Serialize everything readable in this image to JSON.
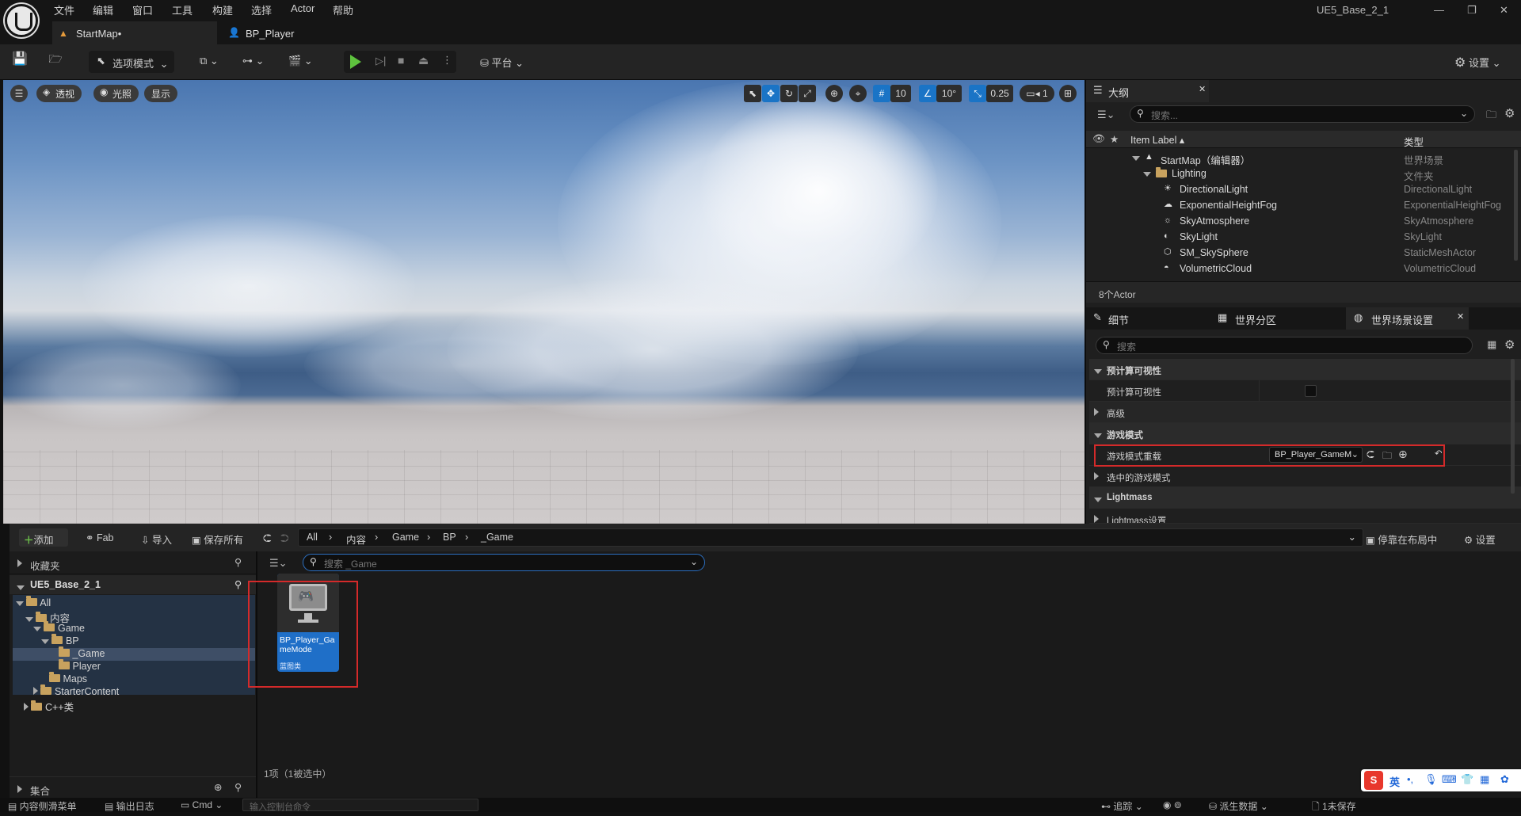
{
  "app": {
    "window_title": "UE5_Base_2_1"
  },
  "menu": [
    "文件",
    "编辑",
    "窗口",
    "工具",
    "构建",
    "选择",
    "Actor",
    "帮助"
  ],
  "tabs": [
    {
      "label": "StartMap•"
    },
    {
      "label": "BP_Player"
    }
  ],
  "toolbar": {
    "mode": "选项模式",
    "platform": "平台",
    "settings": "设置"
  },
  "viewport": {
    "perspective": "透视",
    "lighting": "光照",
    "show": "显示",
    "grid_snap": "10",
    "rotate_snap": "10°",
    "scale_snap": "0.25",
    "camera_speed": "1"
  },
  "outliner": {
    "title": "大纲",
    "search_placeholder": "搜索...",
    "col_label": "Item Label ▴",
    "col_type": "类型",
    "rows": [
      {
        "name": "StartMap（编辑器）",
        "type": "世界场景"
      },
      {
        "name": "Lighting",
        "type": "文件夹"
      },
      {
        "name": "DirectionalLight",
        "type": "DirectionalLight"
      },
      {
        "name": "ExponentialHeightFog",
        "type": "ExponentialHeightFog"
      },
      {
        "name": "SkyAtmosphere",
        "type": "SkyAtmosphere"
      },
      {
        "name": "SkyLight",
        "type": "SkyLight"
      },
      {
        "name": "SM_SkySphere",
        "type": "StaticMeshActor"
      },
      {
        "name": "VolumetricCloud",
        "type": "VolumetricCloud"
      }
    ],
    "count": "8个Actor"
  },
  "details": {
    "tabs": [
      "细节",
      "世界分区",
      "世界场景设置"
    ],
    "search_placeholder": "搜索",
    "sections": [
      {
        "label": "预计算可视性"
      },
      {
        "label": "预计算可视性"
      },
      {
        "label": "高级"
      },
      {
        "label": "游戏模式"
      },
      {
        "label": "游戏模式重载",
        "value": "BP_Player_GameM"
      },
      {
        "label": "选中的游戏模式"
      },
      {
        "label": "Lightmass"
      },
      {
        "label": "Lightmass设置"
      }
    ]
  },
  "content_browser": {
    "add": "添加",
    "fab": "Fab",
    "import": "导入",
    "save_all": "保存所有",
    "path": [
      "All",
      "内容",
      "Game",
      "BP",
      "_Game"
    ],
    "dock": "停靠在布局中",
    "settings": "设置",
    "favorites": "收藏夹",
    "project": "UE5_Base_2_1",
    "tree": [
      "All",
      "内容",
      "Game",
      "BP",
      "_Game",
      "Player",
      "Maps",
      "StarterContent",
      "C++类"
    ],
    "collections": "集合",
    "search_placeholder": "搜索 _Game",
    "asset": {
      "name": "BP_Player_GameMode",
      "type": "蓝图类"
    },
    "status": "1项（1被选中）"
  },
  "statusbar": {
    "content_drawer": "内容侧滑菜单",
    "output_log": "输出日志",
    "cmd": "Cmd",
    "console_placeholder": "输入控制台命令",
    "trace": "追踪",
    "derived_data": "派生数据",
    "unsaved": "1未保存",
    "source_control": "版本控制"
  },
  "ime": {
    "lang": "英"
  }
}
